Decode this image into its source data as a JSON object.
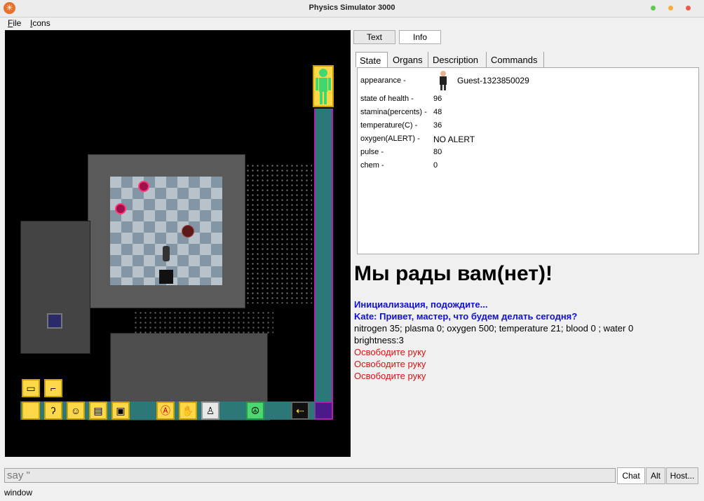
{
  "window": {
    "title": "Physics Simulator 3000"
  },
  "menu": {
    "file": "ile",
    "file_key": "F",
    "icons": "cons",
    "icons_key": "I"
  },
  "right_buttons": {
    "text": "Text",
    "info": "Info"
  },
  "tabs": [
    "State",
    "Organs",
    "Description",
    "Commands"
  ],
  "state": {
    "appearance_label": "appearance -",
    "appearance_value": "Guest-1323850029",
    "health_label": "state of health -",
    "health_value": "96",
    "stamina_label": "stamina(percents) -",
    "stamina_value": "48",
    "temp_label": "temperature(C) -",
    "temp_value": "36",
    "oxygen_label": "oxygen(ALERT) -",
    "oxygen_value": "NO ALERT",
    "pulse_label": "pulse -",
    "pulse_value": "80",
    "chem_label": "chem -",
    "chem_value": "0"
  },
  "chat": {
    "headline": "Мы рады вам(нет)!",
    "line1": "Инициализация, подождите...",
    "line2": "Kate: Привет, мастер, что будем делать сегодня?",
    "line3": "nitrogen 35; plasma 0; oxygen 500; temperature 21; blood 0 ; water 0",
    "line4": "brightness:3",
    "line5": "Освободите руку",
    "line6": "Освободите руку",
    "line7": "Освободите руку"
  },
  "input": {
    "value": "say \""
  },
  "bottom_buttons": {
    "chat": "Chat",
    "alt": "Alt",
    "host": "Host..."
  },
  "status": "window",
  "colors": {
    "hud_yellow": "#ffd84a",
    "alert_red": "#e01010",
    "system_blue": "#1010d8",
    "health_green": "#3fd870"
  }
}
